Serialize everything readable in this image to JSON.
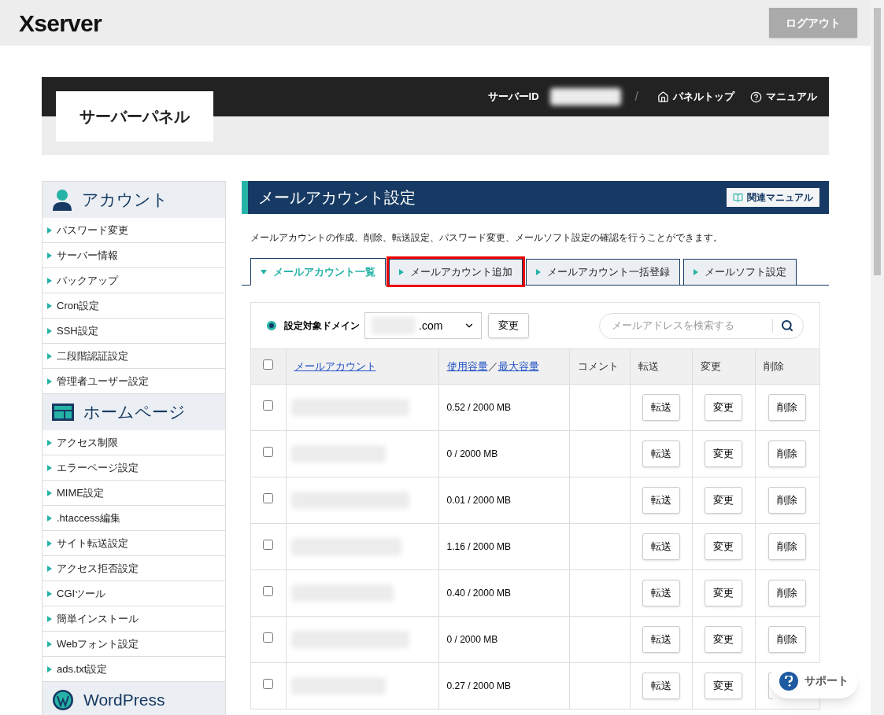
{
  "header": {
    "logo": "Xserver",
    "logout": "ログアウト"
  },
  "panel": {
    "title": "サーバーパネル",
    "server_id_label": "サーバーID",
    "separator": "/",
    "links": [
      {
        "kind": "home",
        "label": "パネルトップ"
      },
      {
        "kind": "help",
        "label": "マニュアル"
      }
    ]
  },
  "sidebar": [
    {
      "kind": "account",
      "title": "アカウント",
      "items": [
        "パスワード変更",
        "サーバー情報",
        "バックアップ",
        "Cron設定",
        "SSH設定",
        "二段階認証設定",
        "管理者ユーザー設定"
      ]
    },
    {
      "kind": "homepage",
      "title": "ホームページ",
      "items": [
        "アクセス制限",
        "エラーページ設定",
        "MIME設定",
        ".htaccess編集",
        "サイト転送設定",
        "アクセス拒否設定",
        "CGIツール",
        "簡単インストール",
        "Webフォント設定",
        "ads.txt設定"
      ]
    },
    {
      "kind": "wordpress",
      "title": "WordPress"
    }
  ],
  "main": {
    "title": "メールアカウント設定",
    "manual_button": "関連マニュアル",
    "description": "メールアカウントの作成、削除、転送設定、パスワード変更、メールソフト設定の確認を行うことができます。",
    "tabs": [
      {
        "label": "メールアカウント一覧",
        "selected": true,
        "highlighted": false
      },
      {
        "label": "メールアカウント追加",
        "selected": false,
        "highlighted": true
      },
      {
        "label": "メールアカウント一括登録",
        "selected": false,
        "highlighted": false
      },
      {
        "label": "メールソフト設定",
        "selected": false,
        "highlighted": false
      }
    ],
    "domain_label": "設定対象ドメイン",
    "domain_value": ".com",
    "change_button": "変更",
    "search": {
      "placeholder": "メールアドレスを検索する"
    },
    "table": {
      "select_all_checked": false,
      "columns": [
        {
          "label": "メールアカウント",
          "link": true
        },
        {
          "label": "使用容量",
          "link": true,
          "suffix": "／",
          "second": "最大容量"
        },
        {
          "label": "コメント",
          "link": false
        },
        {
          "label": "転送",
          "link": false
        },
        {
          "label": "変更",
          "link": false
        },
        {
          "label": "削除",
          "link": false
        }
      ],
      "rows": [
        {
          "checked": false,
          "usage": "0.52 / 2000 MB",
          "forward": "転送",
          "edit": "変更",
          "delete": "削除"
        },
        {
          "checked": false,
          "usage": "0 / 2000 MB",
          "forward": "転送",
          "edit": "変更",
          "delete": "削除"
        },
        {
          "checked": false,
          "usage": "0.01 / 2000 MB",
          "forward": "転送",
          "edit": "変更",
          "delete": "削除"
        },
        {
          "checked": false,
          "usage": "1.16 / 2000 MB",
          "forward": "転送",
          "edit": "変更",
          "delete": "削除"
        },
        {
          "checked": false,
          "usage": "0.40 / 2000 MB",
          "forward": "転送",
          "edit": "変更",
          "delete": "削除"
        },
        {
          "checked": false,
          "usage": "0 / 2000 MB",
          "forward": "転送",
          "edit": "変更",
          "delete": "削除"
        },
        {
          "checked": false,
          "usage": "0.27 / 2000 MB",
          "forward": "転送",
          "edit": "変更"
        }
      ]
    }
  },
  "support": "サポート"
}
